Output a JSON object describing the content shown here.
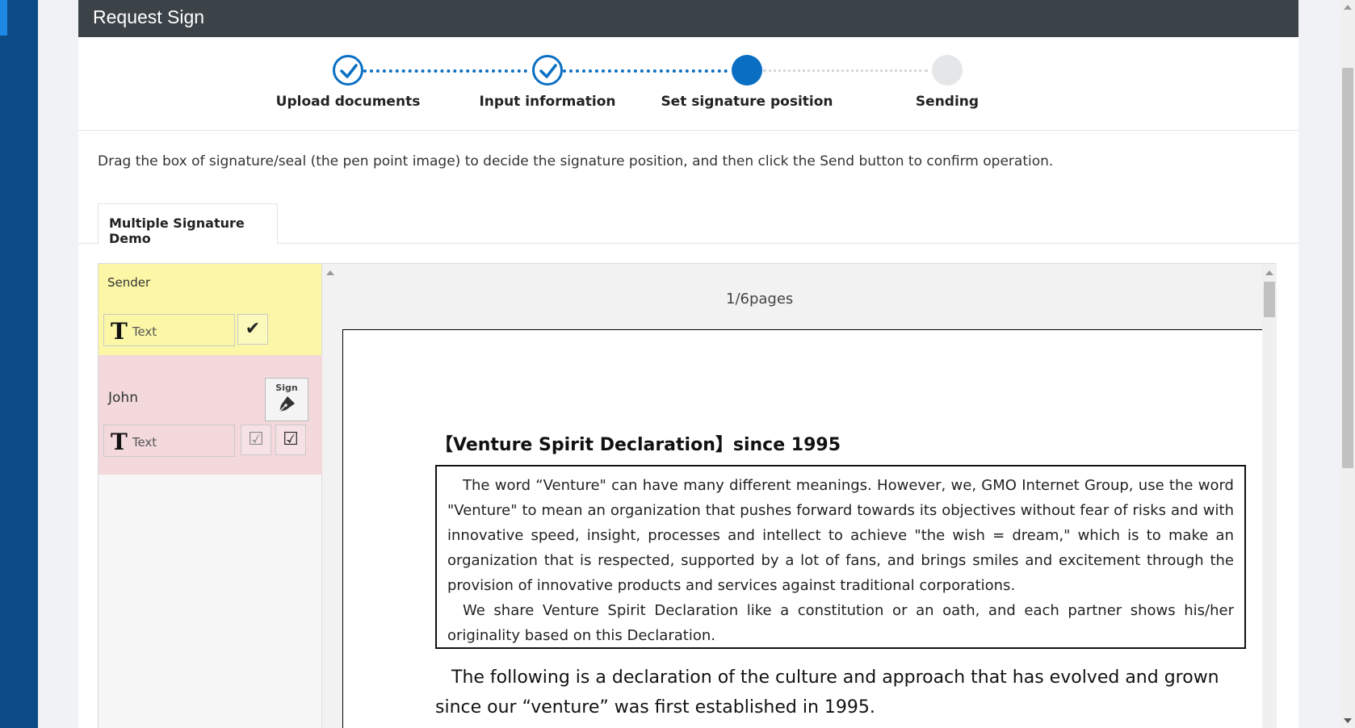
{
  "header": {
    "title": "Request Sign"
  },
  "stepper": {
    "steps": [
      {
        "label": "Upload documents",
        "state": "done"
      },
      {
        "label": "Input information",
        "state": "done"
      },
      {
        "label": "Set signature position",
        "state": "active"
      },
      {
        "label": "Sending",
        "state": "todo"
      }
    ]
  },
  "instruction": "Drag the box of signature/seal (the pen point image) to decide the signature position, and then click the Send button to confirm operation.",
  "tabs": [
    {
      "label": "Multiple Signature Demo"
    }
  ],
  "parties": {
    "sender": {
      "name": "Sender",
      "text_field_label": "Text"
    },
    "john": {
      "name": "John",
      "text_field_label": "Text",
      "sign_label": "Sign"
    }
  },
  "viewer": {
    "page_counter": "1/6pages",
    "document": {
      "title": "【Venture Spirit Declaration】since 1995",
      "paragraphs": [
        "The word “Venture\" can have many different meanings. However, we, GMO Internet Group, use the word \"Venture\" to mean an organization that pushes forward towards its objectives without fear of risks and with innovative speed, insight, processes and intellect to achieve \"the wish = dream,\" which is to make an organization that is respected, supported by a lot of fans, and brings smiles and excitement through the provision of innovative products and services against traditional corporations.",
        "We share Venture Spirit Declaration like a constitution or an oath, and each partner shows his/her originality based on this Declaration."
      ],
      "following": "The following is a declaration of the culture and approach that has evolved and grown since our “venture” was first established in 1995."
    }
  },
  "colors": {
    "primary": "#0a6fc2",
    "nav": "#0d4b86",
    "header": "#3b4248",
    "sender_bg": "#fbf7a6",
    "john_bg": "#f3d9dc"
  }
}
